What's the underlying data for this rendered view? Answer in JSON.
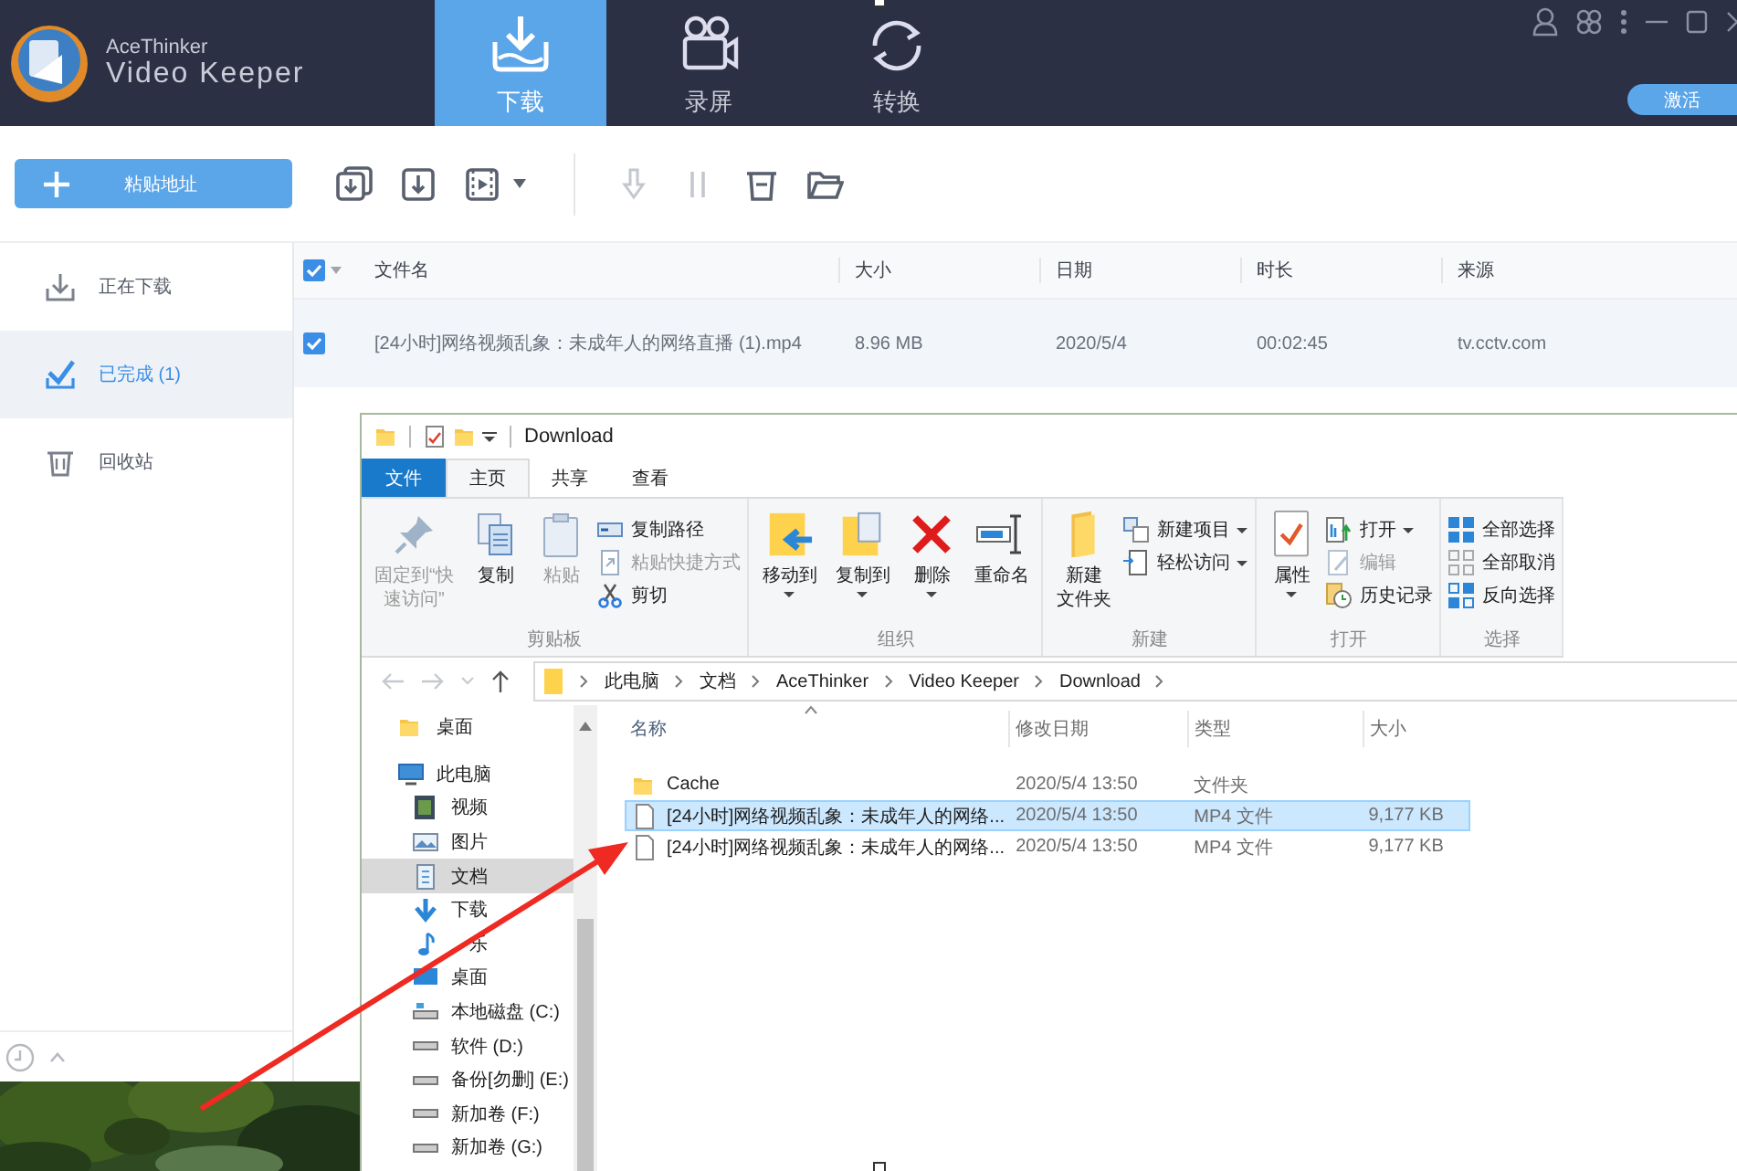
{
  "app": {
    "brand": "AceThinker",
    "product": "Video Keeper",
    "tabs": [
      {
        "label": "下载",
        "selected": true
      },
      {
        "label": "录屏",
        "selected": false
      },
      {
        "label": "转换",
        "selected": false
      }
    ],
    "activate_button": "激活",
    "paste_button": "粘贴地址",
    "toolbar": [
      {
        "disabled": false,
        "menu": false
      },
      {
        "disabled": false,
        "menu": false
      },
      {
        "disabled": false,
        "menu": true
      },
      {
        "disabled": true,
        "menu": false
      },
      {
        "disabled": true,
        "menu": false
      },
      {
        "disabled": false,
        "menu": false
      },
      {
        "disabled": false,
        "menu": false
      }
    ],
    "sidebar": [
      {
        "label": "正在下载",
        "selected": false
      },
      {
        "label": "已完成 (1)",
        "selected": true
      },
      {
        "label": "回收站",
        "selected": false
      }
    ],
    "table": {
      "select_all": true,
      "columns": [
        "文件名",
        "大小",
        "日期",
        "时长",
        "来源"
      ],
      "rows": [
        {
          "checked": true,
          "cells": [
            "[24小时]网络视频乱象：未成年人的网络直播 (1).mp4",
            "8.96 MB",
            "2020/5/4",
            "00:02:45",
            "tv.cctv.com"
          ]
        }
      ]
    }
  },
  "explorer": {
    "title": "Download",
    "file_tab": "文件",
    "tabs": [
      {
        "label": "主页",
        "selected": true
      },
      {
        "label": "共享",
        "selected": false
      },
      {
        "label": "查看",
        "selected": false
      }
    ],
    "ribbon_groups": [
      {
        "label": "剪贴板",
        "buttons": [
          {
            "lines": [
              "固定到“快",
              "速访问”"
            ],
            "kind": "large",
            "disabled": true,
            "menu": false
          },
          {
            "label": "复制",
            "kind": "large",
            "disabled": false,
            "menu": false
          },
          {
            "label": "粘贴",
            "kind": "large",
            "disabled": true,
            "menu": false
          },
          {
            "label": "复制路径",
            "kind": "small",
            "disabled": false,
            "menu": false
          },
          {
            "label": "粘贴快捷方式",
            "kind": "small",
            "disabled": true,
            "menu": false
          },
          {
            "label": "剪切",
            "kind": "small",
            "disabled": false,
            "menu": false
          }
        ]
      },
      {
        "label": "组织",
        "buttons": [
          {
            "label": "移动到",
            "kind": "large",
            "disabled": false,
            "menu": true
          },
          {
            "label": "复制到",
            "kind": "large",
            "disabled": false,
            "menu": true
          },
          {
            "label": "删除",
            "kind": "large",
            "disabled": false,
            "menu": true
          },
          {
            "label": "重命名",
            "kind": "large",
            "disabled": false,
            "menu": false
          }
        ]
      },
      {
        "label": "新建",
        "buttons": [
          {
            "lines": [
              "新建",
              "文件夹"
            ],
            "kind": "large",
            "disabled": false,
            "menu": false
          },
          {
            "label": "新建项目",
            "kind": "small",
            "disabled": false,
            "menu": true
          },
          {
            "label": "轻松访问",
            "kind": "small",
            "disabled": false,
            "menu": true
          }
        ]
      },
      {
        "label": "打开",
        "buttons": [
          {
            "label": "属性",
            "kind": "large",
            "disabled": false,
            "menu": true
          },
          {
            "label": "打开",
            "kind": "small",
            "disabled": false,
            "menu": true
          },
          {
            "label": "编辑",
            "kind": "small",
            "disabled": true,
            "menu": false
          },
          {
            "label": "历史记录",
            "kind": "small",
            "disabled": false,
            "menu": false
          }
        ]
      },
      {
        "label": "选择",
        "buttons": [
          {
            "label": "全部选择",
            "kind": "small",
            "disabled": false,
            "menu": false
          },
          {
            "label": "全部取消",
            "kind": "small",
            "disabled": false,
            "menu": false
          },
          {
            "label": "反向选择",
            "kind": "small",
            "disabled": false,
            "menu": false
          }
        ]
      }
    ],
    "path": [
      "此电脑",
      "文档",
      "AceThinker",
      "Video Keeper",
      "Download"
    ],
    "nav": [
      {
        "label": "桌面",
        "selected": false
      },
      {
        "label": "此电脑",
        "selected": false,
        "children": [
          {
            "label": "视频",
            "selected": false
          },
          {
            "label": "图片",
            "selected": false
          },
          {
            "label": "文档",
            "selected": true
          },
          {
            "label": "下载",
            "selected": false
          },
          {
            "label": "乐",
            "selected": false,
            "covered": true
          },
          {
            "label": "桌面",
            "selected": false
          },
          {
            "label": "本地磁盘 (C:)",
            "selected": false
          },
          {
            "label": "软件 (D:)",
            "selected": false
          },
          {
            "label": "备份[勿删] (E:)",
            "selected": false
          },
          {
            "label": "新加卷 (F:)",
            "selected": false
          },
          {
            "label": "新加卷 (G:)",
            "selected": false
          }
        ]
      }
    ],
    "columns": [
      "名称",
      "修改日期",
      "类型",
      "大小"
    ],
    "files": [
      {
        "kind": "folder",
        "name": "Cache",
        "date": "2020/5/4 13:50",
        "type": "文件夹",
        "selected": false
      },
      {
        "kind": "file",
        "name": "[24小时]网络视频乱象：未成年人的网络...",
        "date": "2020/5/4 13:50",
        "type": "MP4 文件",
        "size": "9,177 KB",
        "selected": true
      },
      {
        "kind": "file",
        "name": "[24小时]网络视频乱象：未成年人的网络...",
        "date": "2020/5/4 13:50",
        "type": "MP4 文件",
        "size": "9,177 KB",
        "selected": false
      }
    ]
  }
}
